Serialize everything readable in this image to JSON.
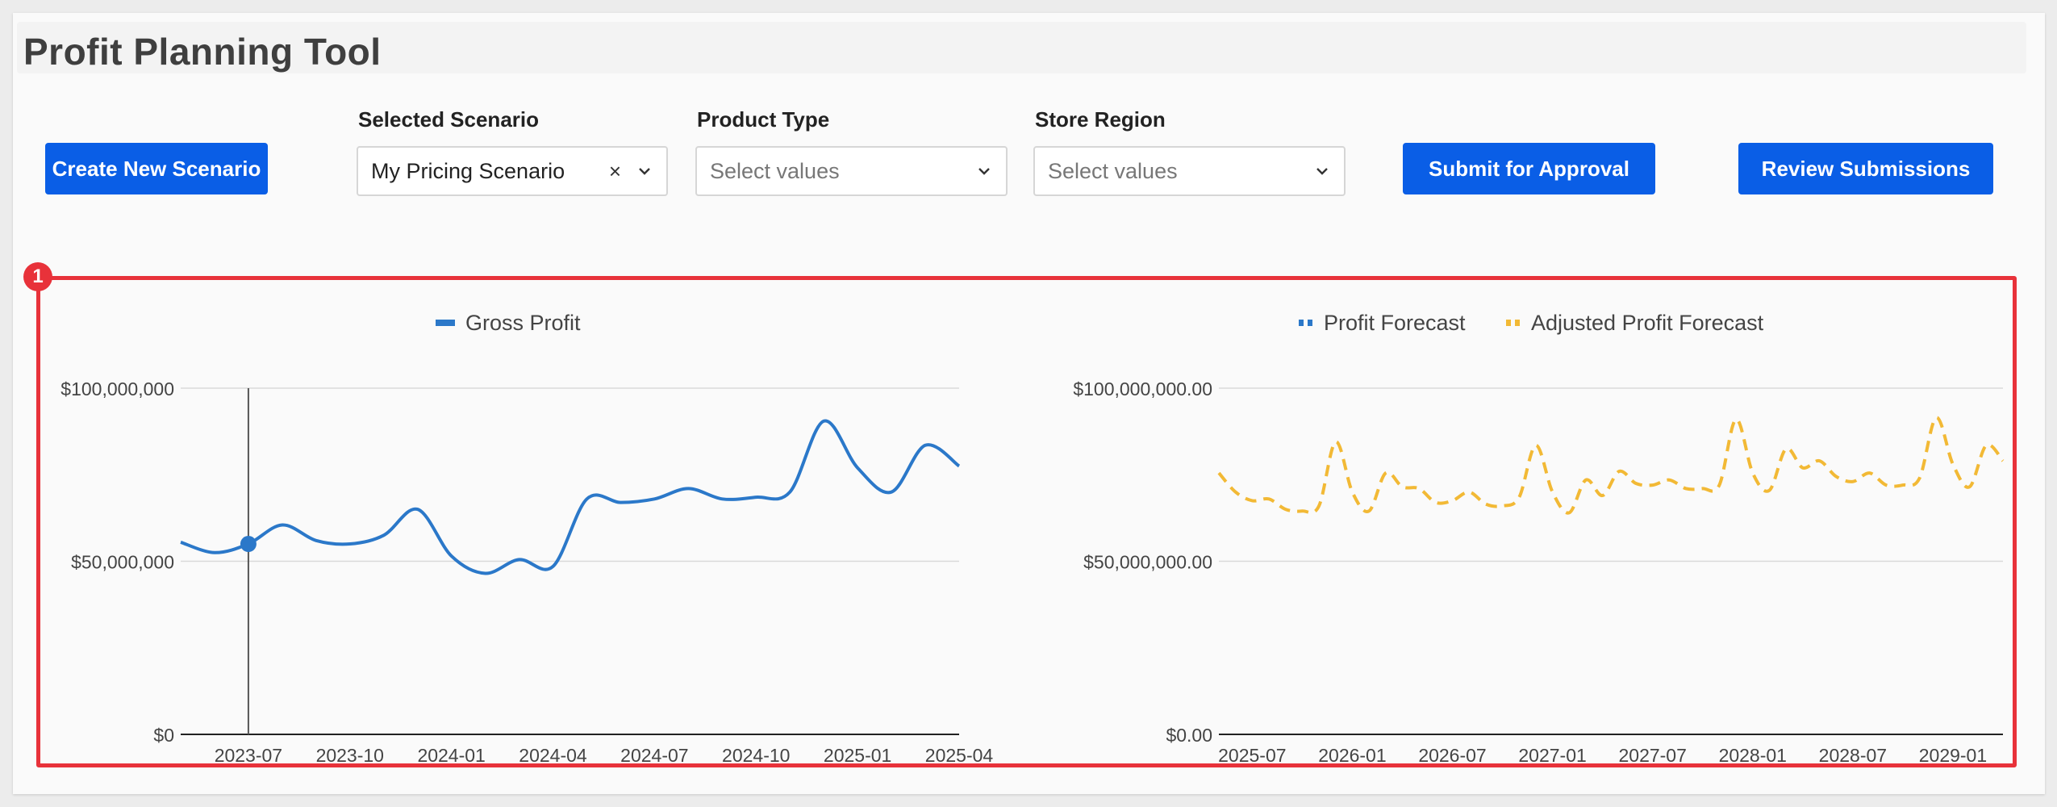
{
  "app": {
    "title": "Profit Planning Tool"
  },
  "buttons": {
    "create": "Create New Scenario",
    "submit": "Submit for Approval",
    "review": "Review Submissions"
  },
  "controls": {
    "scenario": {
      "label": "Selected Scenario",
      "value": "My Pricing Scenario",
      "clear_icon": "×"
    },
    "product_type": {
      "label": "Product Type",
      "placeholder": "Select values"
    },
    "store_region": {
      "label": "Store Region",
      "placeholder": "Select values"
    }
  },
  "annotation": {
    "badge": "1",
    "color": "#e8323a"
  },
  "colors": {
    "accent": "#0a5ee6",
    "gross_profit": "#2b78c9",
    "forecast": "#2b78c9",
    "adjusted_forecast": "#f2b935"
  },
  "chart_data": [
    {
      "type": "line",
      "legend": [
        "Gross Profit"
      ],
      "legend_placement": "top",
      "yticks": [
        "$100,000,000",
        "$50,000,000",
        "$0"
      ],
      "ylim": [
        0,
        100000000
      ],
      "xticks": [
        "2023-07",
        "2023-10",
        "2024-01",
        "2024-04",
        "2024-07",
        "2024-10",
        "2025-01",
        "2025-04"
      ],
      "grid": true,
      "hover": {
        "x": "2023-07",
        "y": 55000000
      },
      "series": [
        {
          "name": "Gross Profit",
          "x": [
            "2023-05",
            "2023-06",
            "2023-07",
            "2023-08",
            "2023-09",
            "2023-10",
            "2023-11",
            "2023-12",
            "2024-01",
            "2024-02",
            "2024-03",
            "2024-04",
            "2024-05",
            "2024-06",
            "2024-07",
            "2024-08",
            "2024-09",
            "2024-10",
            "2024-11",
            "2024-12",
            "2025-01",
            "2025-02",
            "2025-03",
            "2025-04"
          ],
          "values": [
            55500000,
            52500000,
            55000000,
            60500000,
            56000000,
            55000000,
            57500000,
            65000000,
            51500000,
            46500000,
            50500000,
            48500000,
            68000000,
            67000000,
            68000000,
            71000000,
            68000000,
            68500000,
            70000000,
            90500000,
            77000000,
            70000000,
            83500000,
            77500000
          ]
        }
      ]
    },
    {
      "type": "line",
      "legend": [
        "Profit Forecast",
        "Adjusted Profit Forecast"
      ],
      "legend_placement": "top",
      "yticks": [
        "$100,000,000.00",
        "$50,000,000.00",
        "$0.00"
      ],
      "ylim": [
        0,
        100000000
      ],
      "xticks": [
        "2025-07",
        "2026-01",
        "2026-07",
        "2027-01",
        "2027-07",
        "2028-01",
        "2028-07",
        "2029-01"
      ],
      "grid": true,
      "series": [
        {
          "name": "Adjusted Profit Forecast",
          "style": "dashed",
          "x": [
            "2025-05",
            "2025-06",
            "2025-07",
            "2025-08",
            "2025-09",
            "2025-10",
            "2025-11",
            "2025-12",
            "2026-01",
            "2026-02",
            "2026-03",
            "2026-04",
            "2026-05",
            "2026-06",
            "2026-07",
            "2026-08",
            "2026-09",
            "2026-10",
            "2026-11",
            "2026-12",
            "2027-01",
            "2027-02",
            "2027-03",
            "2027-04",
            "2027-05",
            "2027-06",
            "2027-07",
            "2027-08",
            "2027-09",
            "2027-10",
            "2027-11",
            "2027-12",
            "2028-01",
            "2028-02",
            "2028-03",
            "2028-04",
            "2028-05",
            "2028-06",
            "2028-07",
            "2028-08",
            "2028-09",
            "2028-10",
            "2028-11",
            "2028-12",
            "2029-01",
            "2029-02",
            "2029-03",
            "2029-04"
          ],
          "values": [
            75500000,
            70000000,
            67500000,
            68000000,
            65000000,
            64500000,
            66000000,
            84500000,
            70000000,
            64500000,
            75500000,
            71500000,
            71000000,
            67000000,
            67500000,
            70000000,
            66500000,
            66000000,
            68500000,
            83500000,
            70000000,
            64000000,
            73500000,
            69000000,
            76000000,
            72500000,
            72000000,
            73500000,
            71000000,
            71000000,
            72000000,
            91000000,
            75500000,
            70500000,
            82500000,
            77000000,
            79000000,
            74500000,
            73000000,
            75500000,
            72000000,
            72000000,
            74000000,
            91500000,
            78000000,
            71500000,
            83500000,
            79000000
          ]
        }
      ]
    }
  ]
}
